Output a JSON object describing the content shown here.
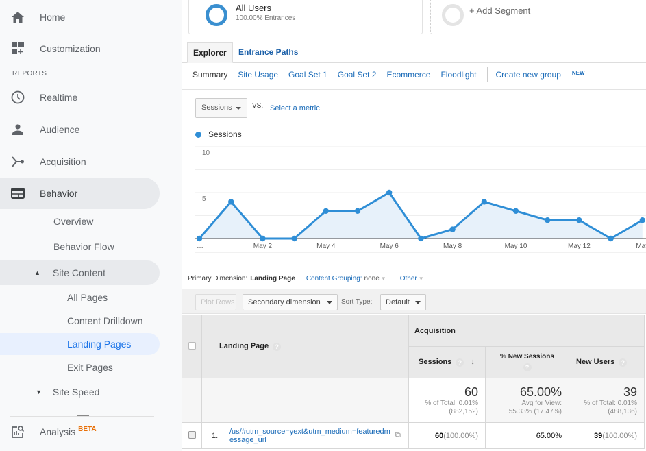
{
  "sidebar": {
    "home": "Home",
    "customization": "Customization",
    "reports_header": "REPORTS",
    "realtime": "Realtime",
    "audience": "Audience",
    "acquisition": "Acquisition",
    "behavior": "Behavior",
    "overview": "Overview",
    "behavior_flow": "Behavior Flow",
    "site_content": "Site Content",
    "all_pages": "All Pages",
    "content_drilldown": "Content Drilldown",
    "landing_pages": "Landing Pages",
    "exit_pages": "Exit Pages",
    "site_speed": "Site Speed",
    "analysis": "Analysis",
    "analysis_badge": "BETA"
  },
  "segments": {
    "active_title": "All Users",
    "active_sub": "100.00% Entrances",
    "add": "+ Add Segment"
  },
  "tabs": [
    {
      "label": "Explorer",
      "active": true
    },
    {
      "label": "Entrance Paths",
      "active": false
    }
  ],
  "subnav": {
    "items": [
      "Summary",
      "Site Usage",
      "Goal Set 1",
      "Goal Set 2",
      "Ecommerce",
      "Floodlight"
    ],
    "create": "Create new group",
    "new_badge": "NEW"
  },
  "metric": {
    "selected": "Sessions",
    "vs": "VS.",
    "select_metric": "Select a metric"
  },
  "chart_data": {
    "type": "line",
    "title": "",
    "legend": [
      "Sessions"
    ],
    "legend_position": "top-left",
    "color": "#2f8ed6",
    "x": [
      "…",
      "",
      "May 2",
      "",
      "May 4",
      "",
      "May 6",
      "",
      "May 8",
      "",
      "May 10",
      "",
      "May 12",
      "",
      "May"
    ],
    "series": [
      {
        "name": "Sessions",
        "values": [
          0,
          4,
          0,
          0,
          3,
          3,
          5,
          0,
          1,
          4,
          3,
          2,
          2,
          0,
          2
        ]
      }
    ],
    "y_ticks": [
      5,
      10
    ],
    "ylim": [
      0,
      10
    ],
    "grid": true
  },
  "dimension": {
    "label": "Primary Dimension:",
    "primary": "Landing Page",
    "grouping_label": "Content Grouping:",
    "grouping_value": "none",
    "other": "Other"
  },
  "toolbar": {
    "plot_rows": "Plot Rows",
    "secondary": "Secondary dimension",
    "sort_label": "Sort Type:",
    "sort_value": "Default"
  },
  "table": {
    "col_landing": "Landing Page",
    "group_acquisition": "Acquisition",
    "col_sessions": "Sessions",
    "col_new_sessions": "% New Sessions",
    "col_new_users": "New Users",
    "totals": {
      "sessions": "60",
      "sessions_sub1": "% of Total: 0.01%",
      "sessions_sub2": "(882,152)",
      "new_sessions": "65.00%",
      "new_sessions_sub1": "Avg for View:",
      "new_sessions_sub2": "55.33% (17.47%)",
      "new_users": "39",
      "new_users_sub1": "% of Total: 0.01%",
      "new_users_sub2": "(488,136)"
    },
    "rows": [
      {
        "index": "1.",
        "url": "/us/#utm_source=yext&utm_medium=featuredmessage_url",
        "sessions": "60",
        "sessions_pct": "(100.00%)",
        "new_sessions": "65.00%",
        "new_users": "39",
        "new_users_pct": "(100.00%)"
      }
    ]
  }
}
